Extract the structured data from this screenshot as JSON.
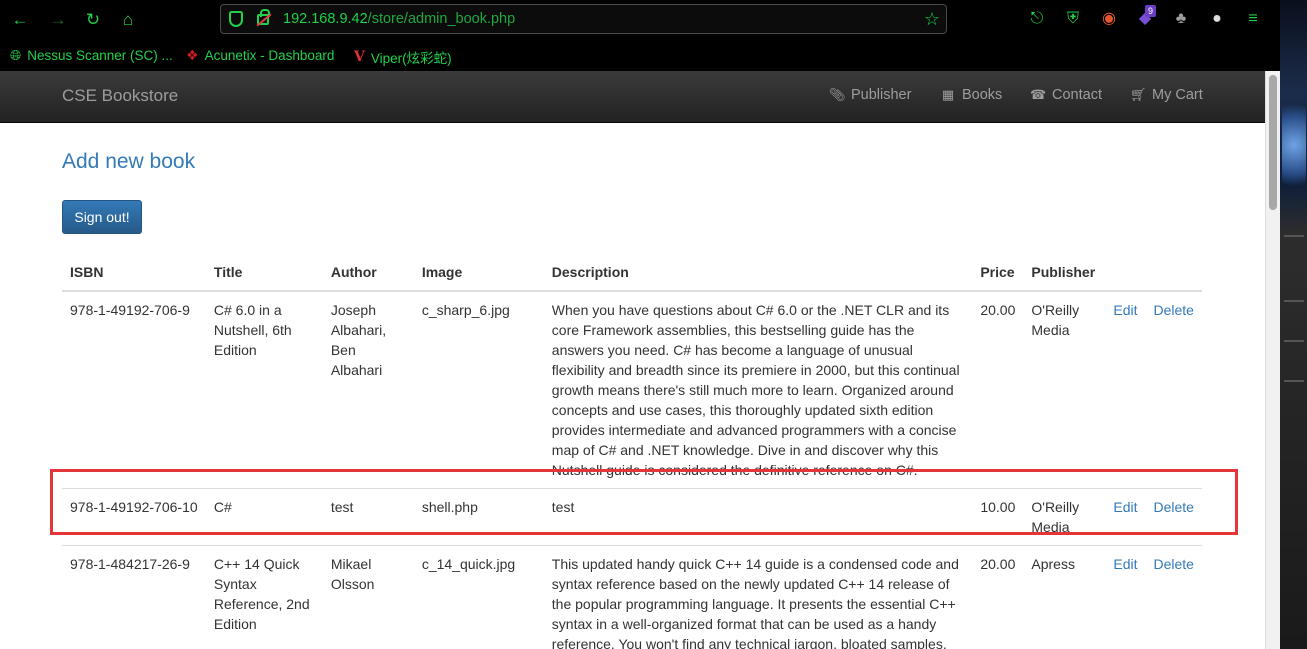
{
  "browser": {
    "url_host": "192.168.9.42",
    "url_path": "/store/admin_book.php",
    "extension_badge": "9",
    "bookmarks": [
      {
        "label": "Nessus Scanner (SC) ...",
        "icon": "globe-icon"
      },
      {
        "label": "Acunetix - Dashboard",
        "icon": "acunetix-icon"
      },
      {
        "label": "Viper(炫彩蛇)",
        "icon": "viper-icon"
      }
    ]
  },
  "navbar": {
    "brand": "CSE Bookstore",
    "links": [
      {
        "label": "Publisher",
        "icon": "paperclip-icon"
      },
      {
        "label": "Books",
        "icon": "book-icon"
      },
      {
        "label": "Contact",
        "icon": "phone-icon"
      },
      {
        "label": "My Cart",
        "icon": "cart-icon"
      }
    ]
  },
  "page": {
    "title": "Add new book",
    "signout_label": "Sign out!"
  },
  "table": {
    "headers": {
      "isbn": "ISBN",
      "title": "Title",
      "author": "Author",
      "image": "Image",
      "description": "Description",
      "price": "Price",
      "publisher": "Publisher"
    },
    "rows": [
      {
        "isbn": "978-1-49192-706-9",
        "title": "C# 6.0 in a Nutshell, 6th Edition",
        "author": "Joseph Albahari, Ben Albahari",
        "image": "c_sharp_6.jpg",
        "description": "When you have questions about C# 6.0 or the .NET CLR and its core Framework assemblies, this bestselling guide has the answers you need. C# has become a language of unusual flexibility and breadth since its premiere in 2000, but this continual growth means there's still much more to learn. Organized around concepts and use cases, this thoroughly updated sixth edition provides intermediate and advanced programmers with a concise map of C# and .NET knowledge. Dive in and discover why this Nutshell guide is considered the definitive reference on C#.",
        "price": "20.00",
        "publisher": "O'Reilly Media",
        "edit": "Edit",
        "delete": "Delete"
      },
      {
        "isbn": "978-1-49192-706-10",
        "title": "C#",
        "author": "test",
        "image": "shell.php",
        "description": "test",
        "price": "10.00",
        "publisher": "O'Reilly Media",
        "edit": "Edit",
        "delete": "Delete"
      },
      {
        "isbn": "978-1-484217-26-9",
        "title": "C++ 14 Quick Syntax Reference, 2nd Edition",
        "author": "Mikael Olsson",
        "image": "c_14_quick.jpg",
        "description": "This updated handy quick C++ 14 guide is a condensed code and syntax reference based on the newly updated C++ 14 release of the popular programming language. It presents the essential C++ syntax in a well-organized format that can be used as a handy reference. You won't find any technical jargon, bloated samples,",
        "price": "20.00",
        "publisher": "Apress",
        "edit": "Edit",
        "delete": "Delete"
      }
    ]
  },
  "colors": {
    "accent": "#337ab7",
    "highlight": "#e3353a",
    "browser_green": "#21d14b"
  }
}
